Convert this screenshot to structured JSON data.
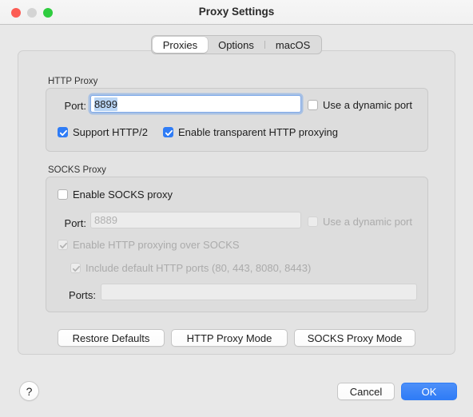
{
  "window": {
    "title": "Proxy Settings",
    "traffic_lights": [
      "close",
      "minimize",
      "zoom"
    ]
  },
  "tabs": [
    {
      "label": "Proxies",
      "selected": true
    },
    {
      "label": "Options",
      "selected": false
    },
    {
      "label": "macOS",
      "selected": false
    }
  ],
  "http_proxy": {
    "group_title": "HTTP Proxy",
    "port_label": "Port:",
    "port_value": "8899",
    "dynamic_port_label": "Use a dynamic port",
    "dynamic_port_checked": false,
    "support_http2_label": "Support HTTP/2",
    "support_http2_checked": true,
    "transparent_label": "Enable transparent HTTP proxying",
    "transparent_checked": true
  },
  "socks_proxy": {
    "group_title": "SOCKS Proxy",
    "enable_label": "Enable SOCKS proxy",
    "enable_checked": false,
    "port_label": "Port:",
    "port_value": "8889",
    "dynamic_port_label": "Use a dynamic port",
    "dynamic_port_checked": false,
    "http_over_socks_label": "Enable HTTP proxying over SOCKS",
    "http_over_socks_checked": true,
    "default_ports_label": "Include default HTTP ports (80, 443, 8080, 8443)",
    "default_ports_checked": true,
    "ports_label": "Ports:",
    "ports_value": ""
  },
  "mode_buttons": {
    "restore_defaults": "Restore Defaults",
    "http_proxy_mode": "HTTP Proxy Mode",
    "socks_proxy_mode": "SOCKS Proxy Mode"
  },
  "footer": {
    "help": "?",
    "cancel": "Cancel",
    "ok": "OK"
  },
  "colors": {
    "accent": "#2f7cf6",
    "window_bg": "#e8e8e8",
    "titlebar_bg": "#f4f4f4",
    "close": "#fc5c54",
    "minimize": "#d4d4d4",
    "zoom": "#2fcc3f",
    "selection": "#b9d5f5"
  }
}
